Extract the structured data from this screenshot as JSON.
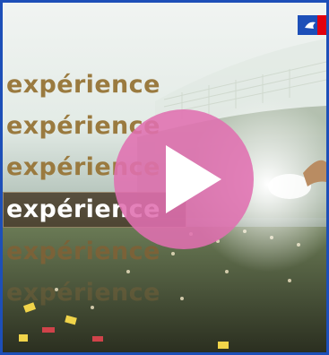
{
  "video": {
    "words": [
      "expérience",
      "expérience",
      "expérience",
      "expérience",
      "expérience",
      "expérience"
    ],
    "highlighted_index": 3,
    "play_icon": "play-icon",
    "logo_icon": "marianne-flag-icon",
    "colors": {
      "frame": "#1d4fb8",
      "play": "#e070b0",
      "text": "#9a7a3f"
    }
  }
}
